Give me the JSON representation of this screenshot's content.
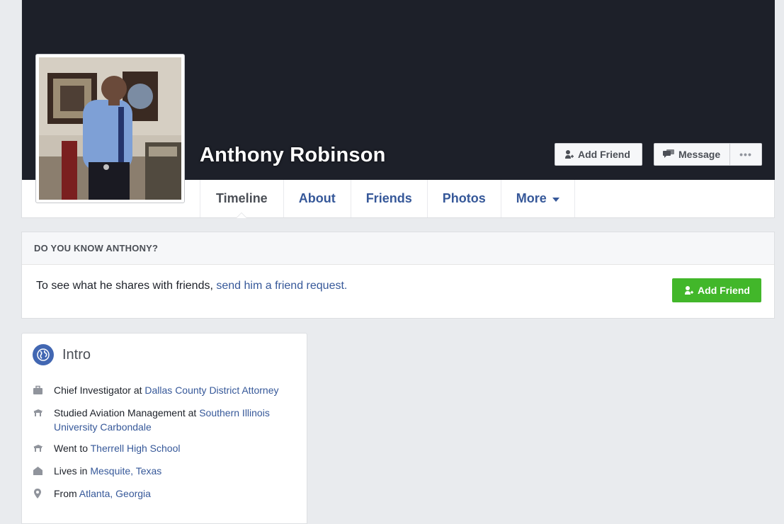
{
  "profile": {
    "name": "Anthony Robinson",
    "add_friend_label": "Add Friend",
    "message_label": "Message",
    "more_dots_label": "•••"
  },
  "tabs": [
    {
      "label": "Timeline",
      "active": true
    },
    {
      "label": "About"
    },
    {
      "label": "Friends"
    },
    {
      "label": "Photos"
    },
    {
      "label": "More"
    }
  ],
  "know": {
    "heading": "DO YOU KNOW ANTHONY?",
    "text": "To see what he shares with friends, ",
    "link": "send him a friend request.",
    "button_label": "Add Friend"
  },
  "intro": {
    "title": "Intro",
    "items": [
      {
        "icon": "briefcase-icon",
        "text": "Chief Investigator at ",
        "link": "Dallas County District Attorney"
      },
      {
        "icon": "school-icon",
        "text": "Studied Aviation Management at ",
        "link": "Southern Illinois University Carbondale"
      },
      {
        "icon": "school-icon",
        "text": "Went to ",
        "link": "Therrell High School"
      },
      {
        "icon": "home-icon",
        "text": "Lives in ",
        "link": "Mesquite, Texas"
      },
      {
        "icon": "pin-icon",
        "text": "From ",
        "link": "Atlanta, Georgia"
      }
    ]
  },
  "colors": {
    "cover": "#1d2029",
    "link": "#365899",
    "green": "#42b72a",
    "background": "#e9ebee"
  }
}
